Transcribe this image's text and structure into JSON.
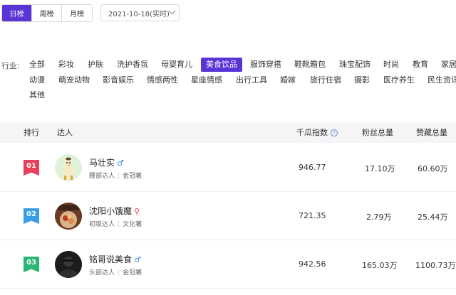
{
  "period_tabs": [
    "日榜",
    "周榜",
    "月榜"
  ],
  "date_select": "2021-10-18(实时)",
  "industry": {
    "label": "行业:",
    "categories": [
      "全部",
      "彩妆",
      "护肤",
      "洗护香氛",
      "母婴育儿",
      "美食饮品",
      "服饰穿搭",
      "鞋靴箱包",
      "珠宝配饰",
      "时尚",
      "教育",
      "家居",
      "动漫",
      "萌宠动物",
      "影音娱乐",
      "情感两性",
      "星座情感",
      "出行工具",
      "婚嫁",
      "旅行住宿",
      "摄影",
      "医疗养生",
      "民生资讯",
      "其他"
    ],
    "active": "美食饮品"
  },
  "table": {
    "headers": {
      "rank": "排行",
      "influencer": "达人",
      "index": "千瓜指数",
      "fans": "粉丝总量",
      "likes": "赞藏总量"
    },
    "rows": [
      {
        "rank": "01",
        "rank_color": "#e8405a",
        "name": "马壮实",
        "gender": "♂",
        "gender_color": "#3a8ee6",
        "level": "腰部达人",
        "tag": "金冠薯",
        "index": "946.77",
        "fans": "17.10万",
        "likes": "60.60万",
        "avatar": "cartoon-chicken"
      },
      {
        "rank": "02",
        "rank_color": "#3a9ee6",
        "name": "沈阳小饿魔",
        "gender": "⚲",
        "gender_color": "#e8405a",
        "level": "初级达人",
        "tag": "文化薯",
        "index": "721.35",
        "fans": "2.79万",
        "likes": "25.44万",
        "avatar": "food-photo"
      },
      {
        "rank": "03",
        "rank_color": "#2bb673",
        "name": "铭哥说美食",
        "gender": "♂",
        "gender_color": "#3a8ee6",
        "level": "头部达人",
        "tag": "金冠薯",
        "index": "942.56",
        "fans": "165.03万",
        "likes": "1100.73万",
        "avatar": "person-dark"
      }
    ]
  }
}
